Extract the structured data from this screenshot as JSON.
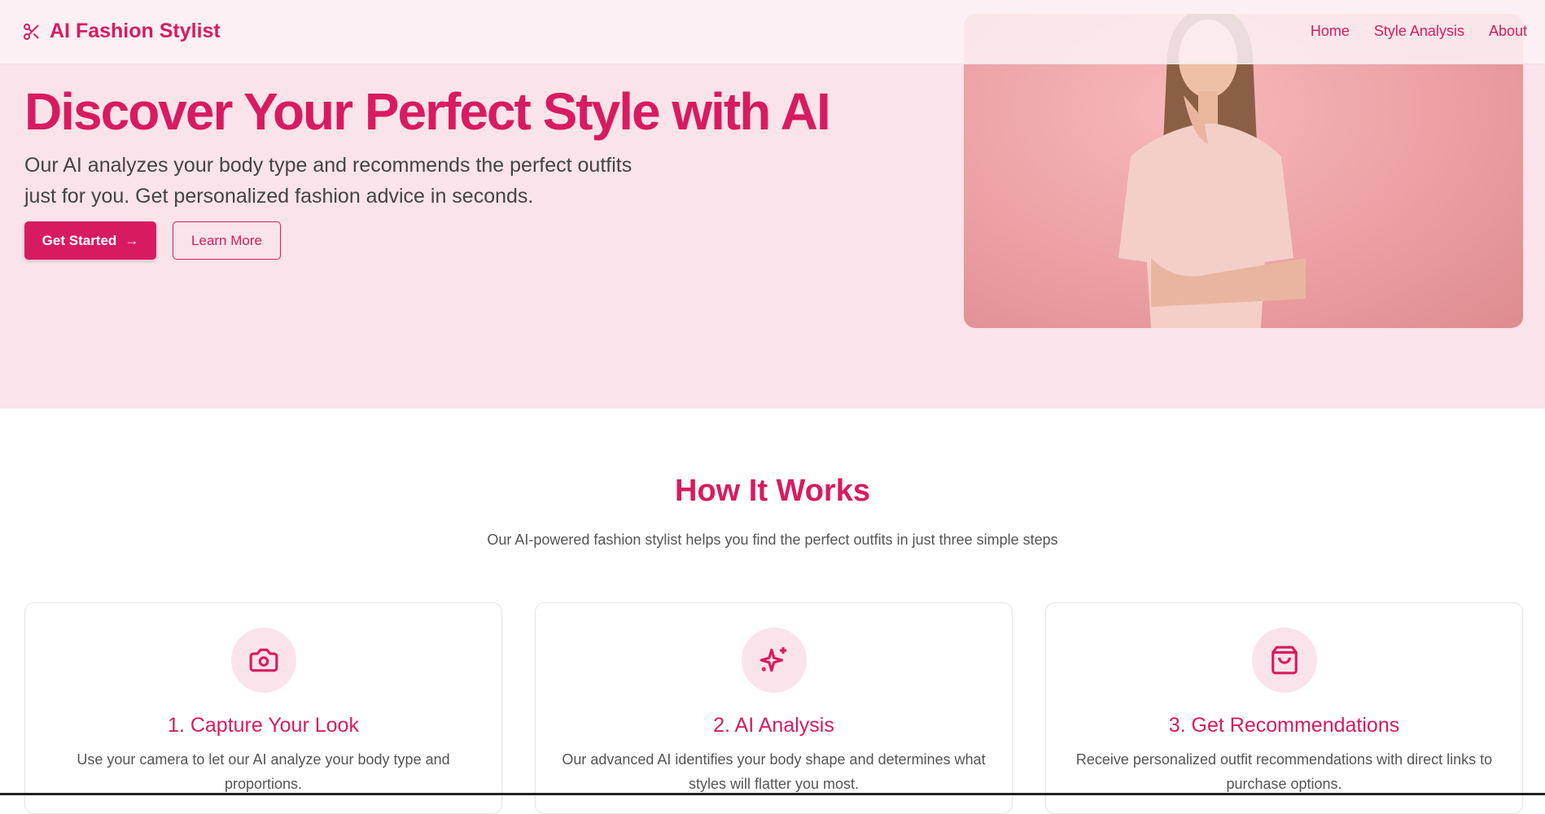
{
  "header": {
    "logo_text": "AI Fashion Stylist",
    "nav": [
      "Home",
      "Style Analysis",
      "About"
    ]
  },
  "hero": {
    "title": "Discover Your Perfect Style with AI",
    "subtitle_line1": "Our AI analyzes your body type and recommends the perfect outfits",
    "subtitle_line2": "just for you. Get personalized fashion advice in seconds.",
    "primary_button": "Get Started",
    "secondary_button": "Learn More"
  },
  "how": {
    "title": "How It Works",
    "subtitle": "Our AI-powered fashion stylist helps you find the perfect outfits in just three simple steps",
    "steps": [
      {
        "icon": "camera-icon",
        "title": "1. Capture Your Look",
        "desc": "Use your camera to let our AI analyze your body type and proportions."
      },
      {
        "icon": "sparkles-icon",
        "title": "2. AI Analysis",
        "desc": "Our advanced AI identifies your body shape and determines what styles will flatter you most."
      },
      {
        "icon": "shopping-bag-icon",
        "title": "3. Get Recommendations",
        "desc": "Receive personalized outfit recommendations with direct links to purchase options."
      }
    ]
  },
  "colors": {
    "accent": "#d81b60",
    "hero_bg": "#fae3ea"
  }
}
